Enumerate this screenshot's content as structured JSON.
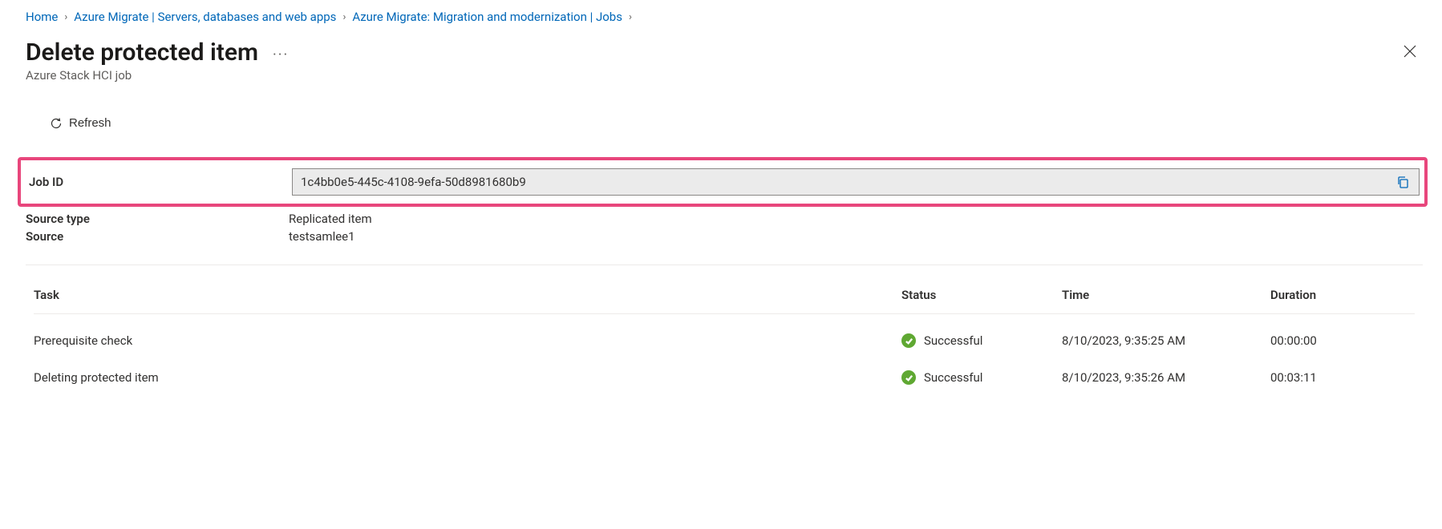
{
  "breadcrumb": {
    "items": [
      {
        "label": "Home"
      },
      {
        "label": "Azure Migrate | Servers, databases and web apps"
      },
      {
        "label": "Azure Migrate: Migration and modernization | Jobs"
      }
    ]
  },
  "header": {
    "title": "Delete protected item",
    "subtitle": "Azure Stack HCI job"
  },
  "toolbar": {
    "refresh_label": "Refresh"
  },
  "props": {
    "job_id_label": "Job ID",
    "job_id_value": "1c4bb0e5-445c-4108-9efa-50d8981680b9",
    "source_type_label": "Source type",
    "source_type_value": "Replicated item",
    "source_label": "Source",
    "source_value": "testsamlee1"
  },
  "table": {
    "headers": {
      "task": "Task",
      "status": "Status",
      "time": "Time",
      "duration": "Duration"
    },
    "rows": [
      {
        "task": "Prerequisite check",
        "status": "Successful",
        "time": "8/10/2023, 9:35:25 AM",
        "duration": "00:00:00"
      },
      {
        "task": "Deleting protected item",
        "status": "Successful",
        "time": "8/10/2023, 9:35:26 AM",
        "duration": "00:03:11"
      }
    ]
  }
}
